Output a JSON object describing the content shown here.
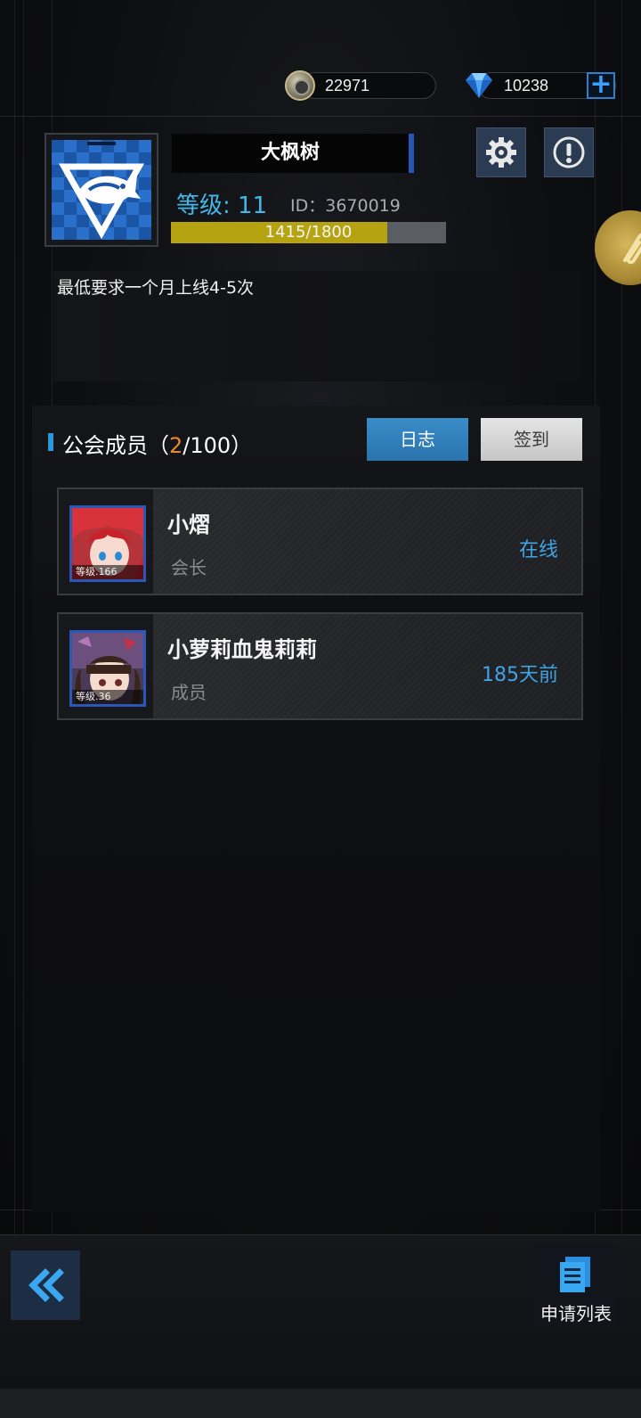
{
  "currency": {
    "coins": "22971",
    "gems": "10238",
    "coin_icon": "silver-coin-icon",
    "gem_icon": "blue-diamond-icon",
    "add_icon": "plus-icon"
  },
  "guild": {
    "name": "大枫树",
    "level_text": "等级: 11",
    "id_text": "ID：3670019",
    "exp_text": "1415/1800",
    "exp_current": 1415,
    "exp_max": 1800,
    "emblem_icon": "fish-emblem-icon",
    "notice": "最低要求一个月上线4-5次"
  },
  "actions": {
    "settings_icon": "gear-icon",
    "info_icon": "exclamation-icon"
  },
  "members_section": {
    "title_prefix": "公会成员（",
    "count_current": "2",
    "count_rest": "/100）",
    "log_label": "日志",
    "signin_label": "签到"
  },
  "members": [
    {
      "name": "小熠",
      "role": "会长",
      "status": "在线",
      "level_badge": "等级.166",
      "avatar_hair": "#c8212a"
    },
    {
      "name": "小萝莉血鬼莉莉",
      "role": "成员",
      "status": "185天前",
      "level_badge": "等级.36",
      "avatar_hair": "#3a241c"
    }
  ],
  "footer": {
    "back_icon": "double-chevron-left-icon",
    "apply_icon": "document-list-icon",
    "apply_label": "申请列表"
  },
  "colors": {
    "accent_blue": "#3fa3e6",
    "exp_fill": "#b5a312",
    "count_orange": "#e8892c"
  }
}
